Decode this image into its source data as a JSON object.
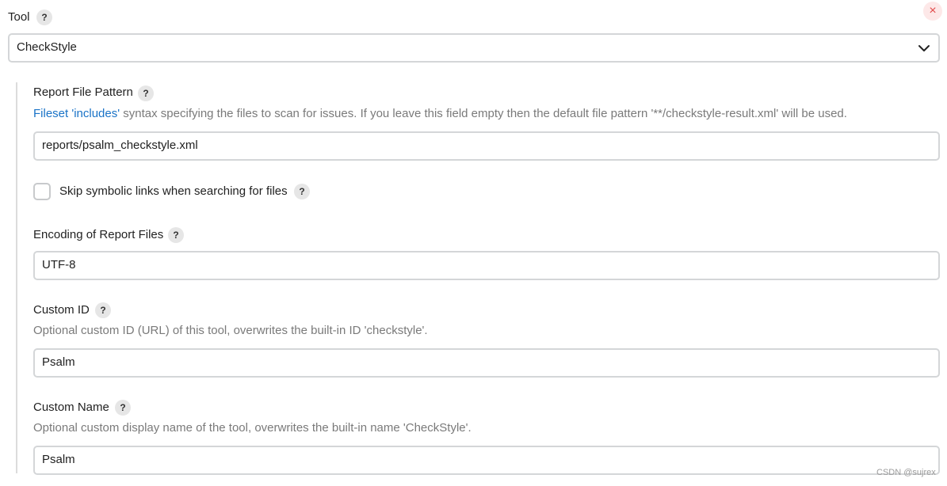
{
  "tool": {
    "label": "Tool",
    "help": "?",
    "selected": "CheckStyle",
    "close_symbol": "×"
  },
  "report_file_pattern": {
    "label": "Report File Pattern",
    "help": "?",
    "desc_link": "Fileset 'includes'",
    "desc_rest": " syntax specifying the files to scan for issues. If you leave this field empty then the default file pattern '**/checkstyle-result.xml' will be used.",
    "value": "reports/psalm_checkstyle.xml"
  },
  "skip_symlinks": {
    "label": "Skip symbolic links when searching for files",
    "help": "?",
    "checked": false
  },
  "encoding": {
    "label": "Encoding of Report Files",
    "help": "?",
    "value": "UTF-8"
  },
  "custom_id": {
    "label": "Custom ID",
    "help": "?",
    "desc": "Optional custom ID (URL) of this tool, overwrites the built-in ID 'checkstyle'.",
    "value": "Psalm"
  },
  "custom_name": {
    "label": "Custom Name",
    "help": "?",
    "desc": "Optional custom display name of the tool, overwrites the built-in name 'CheckStyle'.",
    "value": "Psalm"
  },
  "watermark": "CSDN @sujrex",
  "colors": {
    "link": "#1a73c7",
    "close": "#e24a4a",
    "close_bg": "#fde8e8",
    "border": "#d4d6d8",
    "desc": "#7a7a7a"
  }
}
